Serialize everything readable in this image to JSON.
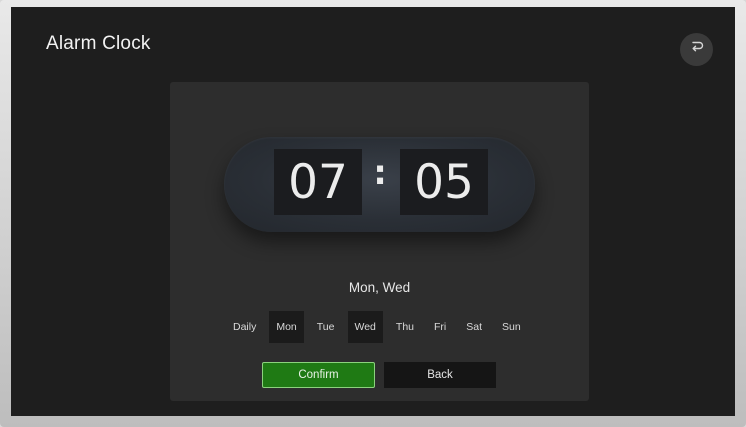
{
  "app": {
    "title": "Alarm Clock"
  },
  "alarm": {
    "hours": "07",
    "separator": ":",
    "minutes": "05",
    "selected_days_text": "Mon, Wed"
  },
  "days": [
    {
      "label": "Daily",
      "active": false
    },
    {
      "label": "Mon",
      "active": true
    },
    {
      "label": "Tue",
      "active": false
    },
    {
      "label": "Wed",
      "active": true
    },
    {
      "label": "Thu",
      "active": false
    },
    {
      "label": "Fri",
      "active": false
    },
    {
      "label": "Sat",
      "active": false
    },
    {
      "label": "Sun",
      "active": false
    }
  ],
  "actions": {
    "confirm_label": "Confirm",
    "back_label": "Back"
  },
  "icons": {
    "top_right": "return-arrow-icon"
  },
  "colors": {
    "background": "#1e1e1e",
    "panel": "#2d2d2d",
    "confirm_green": "#1f7a14",
    "confirm_border": "#8bd27d",
    "day_active_bg": "#1b1b1b"
  }
}
